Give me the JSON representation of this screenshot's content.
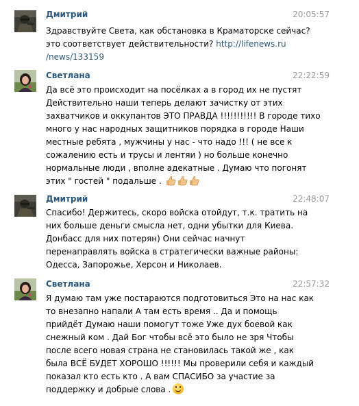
{
  "messages": [
    {
      "author": "Дмитрий",
      "time": "20:05:57",
      "lines": [
        "Здравствуйте Света, как обстановка в Краматорске сейчас?"
      ],
      "link_line_prefix": "это соответствует действительности? ",
      "link_line_link": "http://lifenews.ru",
      "link_line_2": "/news/133159"
    },
    {
      "author": "Светлана",
      "time": "22:22:59",
      "lines": [
        "Да всё это происходит на посёлках а в город их не пустят",
        "Действительно наши теперь делают зачистку от этих",
        "захватчиков и оккупантов ЭТО ПРАВДА !!!!!!!!!!! В городе тихо",
        "много у нас народных защитников порядка в городе Наши",
        "местные ребята , мужчины у нас - что надо !!! ( не все к",
        "сожалению есть и трусы и лентяи ) но больше конечно",
        "нормальные люди , вполне адекатные . Думаю что погонят",
        "этих \" гостей \" подальше ."
      ]
    },
    {
      "author": "Дмитрий",
      "time": "22:48:07",
      "lines": [
        "Спасибо! Держитесь, скоро войска отойдут, т.к. тратить на",
        "них больше деньги смысла нет, одни убытки для Киева.",
        "Донбасс для них потерян) Они сейчас начнут",
        "перенаправлять войска в стратегически важные районы:",
        "Одесса, Запорожье, Херсон и Николаев."
      ]
    },
    {
      "author": "Светлана",
      "time": "22:57:32",
      "lines": [
        "Я думаю там уже постараются подготовиться Это на нас как",
        "то внезапно напали А там есть время .. Да и помощь",
        "прийдёт Думаю наши помогут тоже Уже дух боевой как",
        "снежный ком . Дай Бог чтобы всё это было не зря Чтобы",
        "после всего новая страна не становилась такой же , как",
        "была ВСЁ БУДЕТ ХОРОШО !!!!!! Мы проверили себя и каждый",
        "показал кто есть кто . А вам СПАСИБО за участие за",
        "поддержку и добрые слова ."
      ]
    }
  ],
  "icons": {
    "avatar_dmitry": "avatar-dark-soldier",
    "avatar_svetlana": "avatar-woman-portrait",
    "thumbs_up": "thumbs-up-emoji",
    "smile": "smiling-face-emoji"
  },
  "colors": {
    "author": "#2b587a",
    "time": "#999999",
    "link": "#2b587a"
  }
}
